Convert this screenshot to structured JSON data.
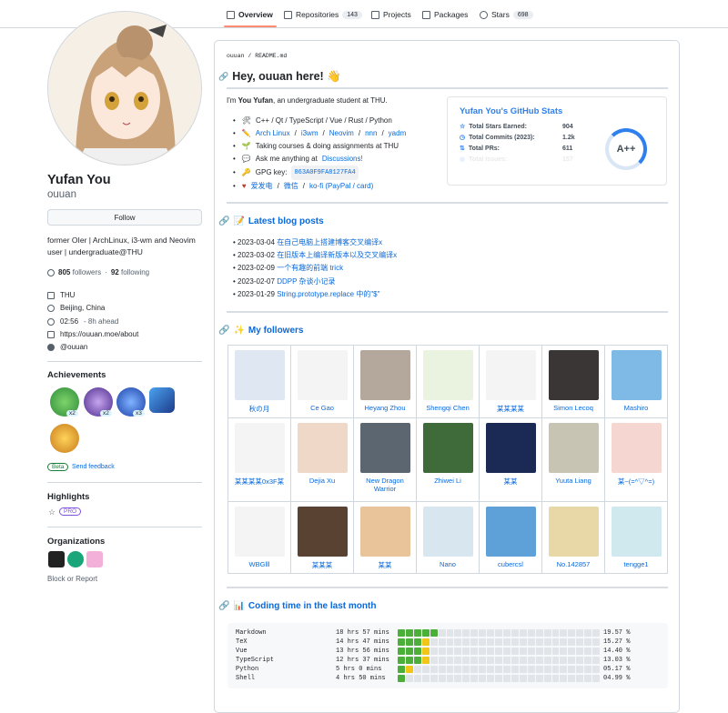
{
  "tabs": [
    {
      "label": "Overview",
      "count": ""
    },
    {
      "label": "Repositories",
      "count": "143"
    },
    {
      "label": "Projects",
      "count": ""
    },
    {
      "label": "Packages",
      "count": ""
    },
    {
      "label": "Stars",
      "count": "698"
    }
  ],
  "profile": {
    "name": "Yufan You",
    "login": "ouuan",
    "follow_label": "Follow",
    "bio": "former OIer | ArchLinux, i3-wm and Neovim user | undergraduate@THU",
    "followers": "805",
    "followers_label": "followers",
    "following": "92",
    "following_label": "following",
    "org": "THU",
    "location": "Beijing, China",
    "time": "02:56",
    "time_ahead": "- 8h ahead",
    "website": "https://ouuan.moe/about",
    "twitter": "@ouuan"
  },
  "sidebar": {
    "achievements_title": "Achievements",
    "ach_counts": [
      "x2",
      "x2",
      "x3"
    ],
    "beta_label": "Beta",
    "feedback_label": "Send feedback",
    "highlights_title": "Highlights",
    "pro_label": "PRO",
    "orgs_title": "Organizations",
    "block_label": "Block or Report"
  },
  "readme": {
    "path_user": "ouuan",
    "path_file": "README.md",
    "heading": "Hey, ouuan here! 👋",
    "intro_pre": "I'm ",
    "intro_name": "You Yufan",
    "intro_post": ", an undergraduate student at THU.",
    "bullets": {
      "langs": "C++ / Qt / TypeScript / Vue / Rust / Python",
      "tools": [
        "Arch Linux",
        "i3wm",
        "Neovim",
        "nnn",
        "yadm"
      ],
      "study": "Taking courses & doing assignments at THU",
      "ask_pre": "Ask me anything at ",
      "ask_link": "Discussions!",
      "gpg_label": "GPG key:",
      "gpg": "863A0F9FA8127FA4",
      "donate": [
        "爱发电",
        "微信",
        "ko-fi (PayPal / card)"
      ]
    }
  },
  "stats": {
    "title": "Yufan You's GitHub Stats",
    "rows": [
      {
        "label": "Total Stars Earned:",
        "value": "904"
      },
      {
        "label": "Total Commits (2023):",
        "value": "1.2k"
      },
      {
        "label": "Total PRs:",
        "value": "611"
      },
      {
        "label": "Total Issues:",
        "value": "157"
      }
    ],
    "grade": "A++"
  },
  "blog": {
    "title": "Latest blog posts",
    "posts": [
      {
        "date": "2023-03-04",
        "title": "在自己电脑上搭建博客交叉编译x"
      },
      {
        "date": "2023-03-02",
        "title": "在旧版本上编译新版本以及交叉编译x"
      },
      {
        "date": "2023-02-09",
        "title": "一个有趣的前端 trick"
      },
      {
        "date": "2023-02-07",
        "title": "DDPP 杂谈小记录"
      },
      {
        "date": "2023-01-29",
        "title": "String.prototype.replace 中的\"$\""
      }
    ]
  },
  "followers": {
    "title": "My followers",
    "rows": [
      [
        "秋の月",
        "Ce Gao",
        "Heyang Zhou",
        "Shengqi Chen",
        "某某某某",
        "Simon Lecoq",
        "Mashiro"
      ],
      [
        "某某某某0x3F某",
        "Dejia Xu",
        "New Dragon Warrior",
        "Zhiwei Li",
        "某某",
        "Yuuta Liang",
        "某~(=^▽^=)"
      ],
      [
        "WBGlll",
        "某某某",
        "某某",
        "Nano",
        "cubercsl",
        "No.142857",
        "tengge1"
      ]
    ],
    "colors": [
      [
        "#dfe8f2",
        "#f4f4f4",
        "#b4a89c",
        "#e9f3e0",
        "#f4f4f4",
        "#3a3636",
        "#7fb9e6"
      ],
      [
        "#f4f4f4",
        "#f0d8c8",
        "#5c6670",
        "#3f6a3a",
        "#1b2a55",
        "#c8c4b4",
        "#f6d6d0"
      ],
      [
        "#f4f4f4",
        "#5a4232",
        "#e9c49a",
        "#d8e6f0",
        "#5ea0d8",
        "#e8d8a8",
        "#cfe9ee"
      ]
    ]
  },
  "coding": {
    "title": "Coding time in the last month",
    "rows": [
      {
        "lang": "Markdown",
        "time": "18 hrs 57 mins",
        "filled": 5,
        "partial": 0,
        "pct": "19.57 %"
      },
      {
        "lang": "TeX",
        "time": "14 hrs 47 mins",
        "filled": 3,
        "partial": 1,
        "pct": "15.27 %"
      },
      {
        "lang": "Vue",
        "time": "13 hrs 56 mins",
        "filled": 3,
        "partial": 1,
        "pct": "14.40 %"
      },
      {
        "lang": "TypeScript",
        "time": "12 hrs 37 mins",
        "filled": 3,
        "partial": 1,
        "pct": "13.03 %"
      },
      {
        "lang": "Python",
        "time": "5 hrs 0 mins",
        "filled": 1,
        "partial": 1,
        "pct": "05.17 %"
      },
      {
        "lang": "Shell",
        "time": "4 hrs 50 mins",
        "filled": 1,
        "partial": 0,
        "pct": "04.99 %"
      }
    ],
    "fill_color": "#4caf3a",
    "partial_color": "#f2c617"
  }
}
